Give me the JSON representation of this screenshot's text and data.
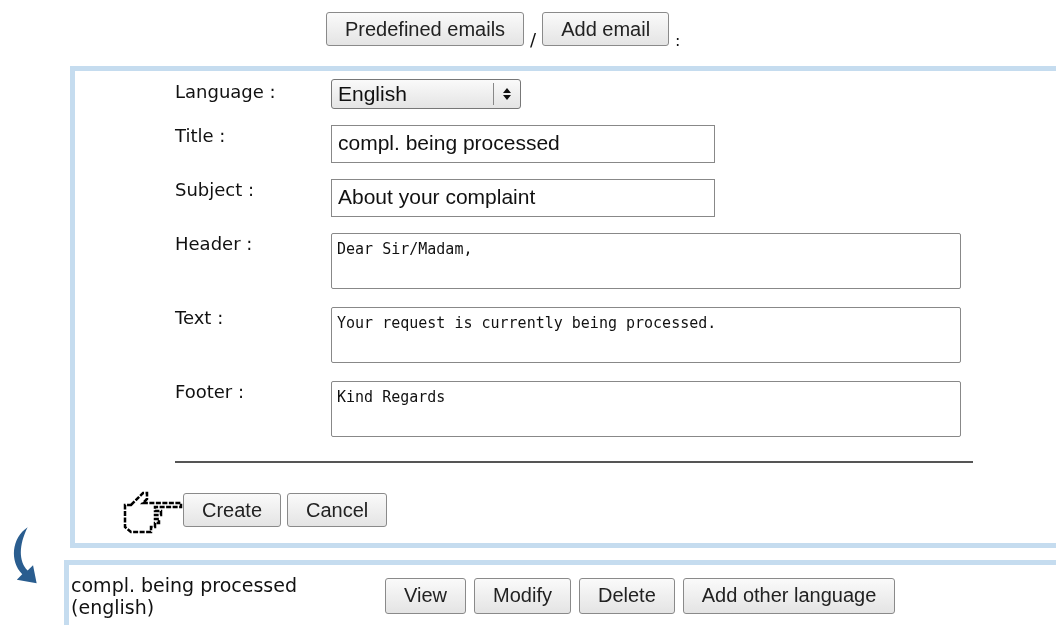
{
  "top_buttons": [
    {
      "label": "Predefined emails"
    },
    {
      "label": "Add email"
    }
  ],
  "separator": "/",
  "trailing": ":",
  "form": {
    "fields": [
      {
        "kind": "select",
        "label": "Language :",
        "value": "English"
      },
      {
        "kind": "input",
        "label": "Title :",
        "value": "compl. being processed"
      },
      {
        "kind": "input",
        "label": "Subject :",
        "value": "About your complaint"
      },
      {
        "kind": "textarea",
        "label": "Header :",
        "value": "Dear Sir/Madam,"
      },
      {
        "kind": "textarea",
        "label": "Text :",
        "value": "Your request is currently being processed."
      },
      {
        "kind": "textarea",
        "label": "Footer :",
        "value": "Kind Regards"
      }
    ],
    "buttons": [
      {
        "label": "Create"
      },
      {
        "label": "Cancel"
      }
    ]
  },
  "result": {
    "name": "compl. being processed (english)",
    "buttons": [
      {
        "label": "View"
      },
      {
        "label": "Modify"
      },
      {
        "label": "Delete"
      },
      {
        "label": "Add other language"
      }
    ]
  }
}
